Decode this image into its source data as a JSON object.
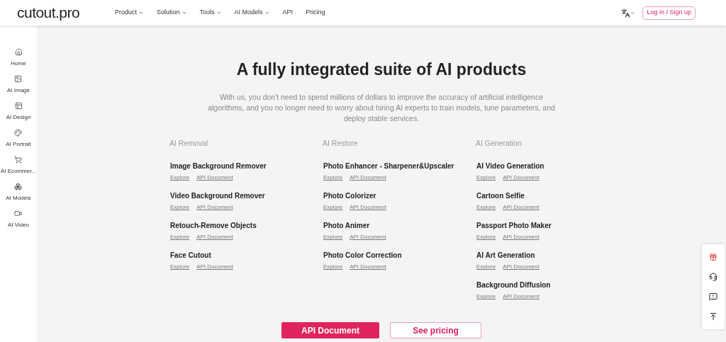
{
  "header": {
    "logo": "cutout.pro",
    "nav": [
      {
        "label": "Product",
        "has_menu": true
      },
      {
        "label": "Solution",
        "has_menu": true
      },
      {
        "label": "Tools",
        "has_menu": true
      },
      {
        "label": "AI Models",
        "has_menu": true
      },
      {
        "label": "API",
        "has_menu": false
      },
      {
        "label": "Pricing",
        "has_menu": false
      }
    ],
    "login": "Log in / Sign up"
  },
  "sidebar": {
    "items": [
      {
        "label": "Home"
      },
      {
        "label": "AI Image"
      },
      {
        "label": "AI Design"
      },
      {
        "label": "AI Portrait"
      },
      {
        "label": "AI Ecommer..."
      },
      {
        "label": "AI Models"
      },
      {
        "label": "AI Video"
      }
    ]
  },
  "hero": {
    "title": "A fully integrated suite of AI products",
    "description": "With us, you don't need to spend millions of dollars to improve the accuracy of artificial intelligence algorithms, and you no longer need to worry about hiring AI experts to train models, tune parameters, and deploy stable services."
  },
  "categories": [
    {
      "title": "AI Removal",
      "products": [
        {
          "name": "Image Background Remover",
          "links": [
            "Explore",
            "API Document"
          ]
        },
        {
          "name": "Video Background Remover",
          "links": [
            "Explore",
            "API Document"
          ]
        },
        {
          "name": "Retouch-Remove Objects",
          "links": [
            "Explore",
            "API Document"
          ]
        },
        {
          "name": "Face Cutout",
          "links": [
            "Explore",
            "API Document"
          ]
        }
      ]
    },
    {
      "title": "AI Restore",
      "products": [
        {
          "name": "Photo Enhancer - Sharpener&Upscaler",
          "links": [
            "Explore",
            "API Document"
          ]
        },
        {
          "name": "Photo Colorizer",
          "links": [
            "Explore",
            "API Document"
          ]
        },
        {
          "name": "Photo Animer",
          "links": [
            "Explore",
            "API Document"
          ]
        },
        {
          "name": "Photo Color Correction",
          "links": [
            "Explore",
            "API Document"
          ]
        }
      ]
    },
    {
      "title": "AI Generation",
      "products": [
        {
          "name": "AI Video Generation",
          "links": [
            "Explore",
            "API Document"
          ]
        },
        {
          "name": "Cartoon Selfie",
          "links": [
            "Explore",
            "API Document"
          ]
        },
        {
          "name": "Passport Photo Maker",
          "links": [
            "Explore",
            "API Document"
          ]
        },
        {
          "name": "AI Art Generation",
          "links": [
            "Explore",
            "API Document"
          ]
        },
        {
          "name": "Background Diffusion",
          "links": [
            "Explore",
            "API Document"
          ]
        }
      ]
    }
  ],
  "actions": [
    {
      "label": "API Document",
      "kind": "primary"
    },
    {
      "label": "See pricing",
      "kind": "outline"
    }
  ]
}
